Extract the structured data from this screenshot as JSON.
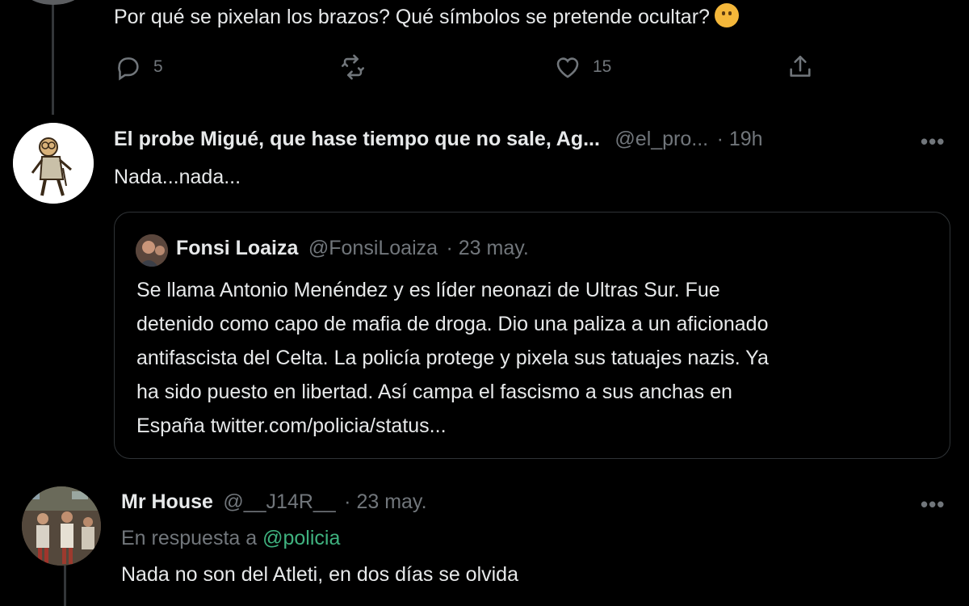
{
  "tweet1": {
    "text": "Por qué se pixelan los brazos? Qué símbolos se pretende ocultar?",
    "emoji": "thinking-face",
    "replies": "5",
    "retweets": "",
    "likes": "15"
  },
  "tweet2": {
    "name": "El probe Migué, que hase tiempo que no sale, Ag...",
    "handle": "@el_pro...",
    "time": "· 19h",
    "more": "•••",
    "text": "Nada...nada...",
    "quote": {
      "name": "Fonsi Loaiza",
      "handle": "@FonsiLoaiza",
      "date": "· 23 may.",
      "lines": [
        "Se llama Antonio Menéndez y es líder neonazi de Ultras Sur. Fue",
        "detenido como capo de mafia de droga. Dio una paliza a un aficionado",
        "antifascista del Celta. La policía protege y pixela sus tatuajes nazis. Ya",
        "ha sido puesto en libertad. Así campa el fascismo a sus anchas en",
        "España twitter.com/policia/status..."
      ]
    }
  },
  "tweet3": {
    "name": "Mr House",
    "handle": "@__J14R__",
    "date": "· 23 may.",
    "more": "•••",
    "reply_prefix": "En respuesta a",
    "reply_to": "@policia",
    "text": "Nada no son del Atleti, en dos días se olvida"
  },
  "colors": {
    "background": "#000000",
    "text": "#e7e9ea",
    "muted": "#71767b",
    "link_green": "#3fb27f",
    "border": "#2f3336"
  }
}
